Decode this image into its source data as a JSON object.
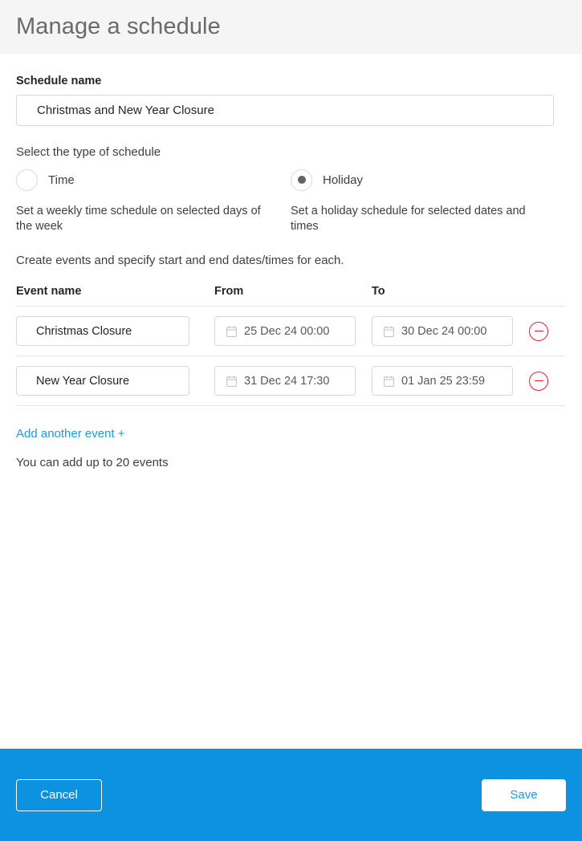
{
  "header": {
    "title": "Manage a schedule"
  },
  "schedule_name": {
    "label": "Schedule name",
    "value": "Christmas and New Year Closure",
    "placeholder": "Schedule name"
  },
  "schedule_type": {
    "label": "Select the type of schedule",
    "selected": "holiday",
    "options": [
      {
        "id": "time",
        "label": "Time",
        "description": "Set a weekly time schedule on selected days of the week",
        "selected": false
      },
      {
        "id": "holiday",
        "label": "Holiday",
        "description": "Set a holiday schedule for selected dates and times",
        "selected": true
      }
    ]
  },
  "events": {
    "intro": "Create events and specify start and end dates/times for each.",
    "columns": {
      "name": "Event name",
      "from": "From",
      "to": "To"
    },
    "rows": [
      {
        "name": "Christmas Closure",
        "from": "25 Dec 24 00:00",
        "to": "30 Dec 24 00:00",
        "name_placeholder": "Event name",
        "remove_icon": "circle-minus-icon"
      },
      {
        "name": "New Year Closure",
        "from": "31 Dec 24 17:30",
        "to": "01 Jan 25 23:59",
        "name_placeholder": "Event name",
        "remove_icon": "circle-minus-icon"
      }
    ],
    "add_link": "Add another event +",
    "limit_text": "You can add up to 20 events",
    "date_icon": "calendar-icon"
  },
  "footer": {
    "cancel_label": "Cancel",
    "save_label": "Save"
  },
  "colors": {
    "accent_blue": "#1a9ae4",
    "footer_blue": "#0d91e1",
    "header_bg": "#f5f5f5",
    "remove_red": "#e8192c",
    "border_gray": "#d6d8da",
    "divider_gray": "#e4e6e8"
  }
}
